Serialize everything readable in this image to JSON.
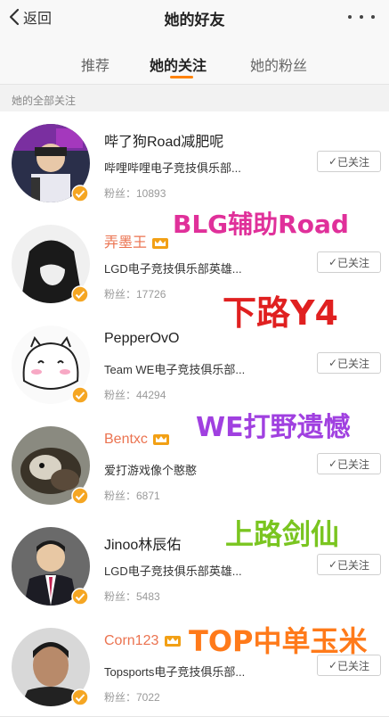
{
  "nav": {
    "back_label": "返回",
    "title": "她的好友"
  },
  "tabs": [
    {
      "label": "推荐"
    },
    {
      "label": "她的关注"
    },
    {
      "label": "她的粉丝"
    }
  ],
  "section_header": "她的全部关注",
  "users": [
    {
      "name": "哔了狗Road减肥呢",
      "desc": "哔哩哔哩电子竞技俱乐部...",
      "fans": "粉丝：10893",
      "follow_label": "已关注"
    },
    {
      "name": "弄墨王",
      "desc": "LGD电子竞技俱乐部英雄...",
      "fans": "粉丝：17726",
      "follow_label": "已关注"
    },
    {
      "name": "PepperOvO",
      "desc": "Team WE电子竞技俱乐部...",
      "fans": "粉丝：44294",
      "follow_label": "已关注"
    },
    {
      "name": "Bentxc",
      "desc": "爱打游戏像个憨憨",
      "fans": "粉丝：6871",
      "follow_label": "已关注"
    },
    {
      "name": "Jinoo林辰佑",
      "desc": "LGD电子竞技俱乐部英雄...",
      "fans": "粉丝：5483",
      "follow_label": "已关注"
    },
    {
      "name": "Corn123",
      "desc": "Topsports电子竞技俱乐部...",
      "fans": "粉丝：7022",
      "follow_label": "已关注"
    }
  ],
  "overlays": [
    {
      "text": "BLG辅助Road",
      "color": "#e0309a"
    },
    {
      "text": "下路Y4",
      "color": "#e02020"
    },
    {
      "text": "WE打野遗憾",
      "color": "#a040e0"
    },
    {
      "text": "上路剑仙",
      "color": "#7ac520"
    },
    {
      "text": "TOP中单玉米",
      "color": "#ff7a1a"
    }
  ],
  "colors": {
    "accent": "#ff8200",
    "verified": "#f5a623",
    "vip_name": "#eb7350"
  }
}
